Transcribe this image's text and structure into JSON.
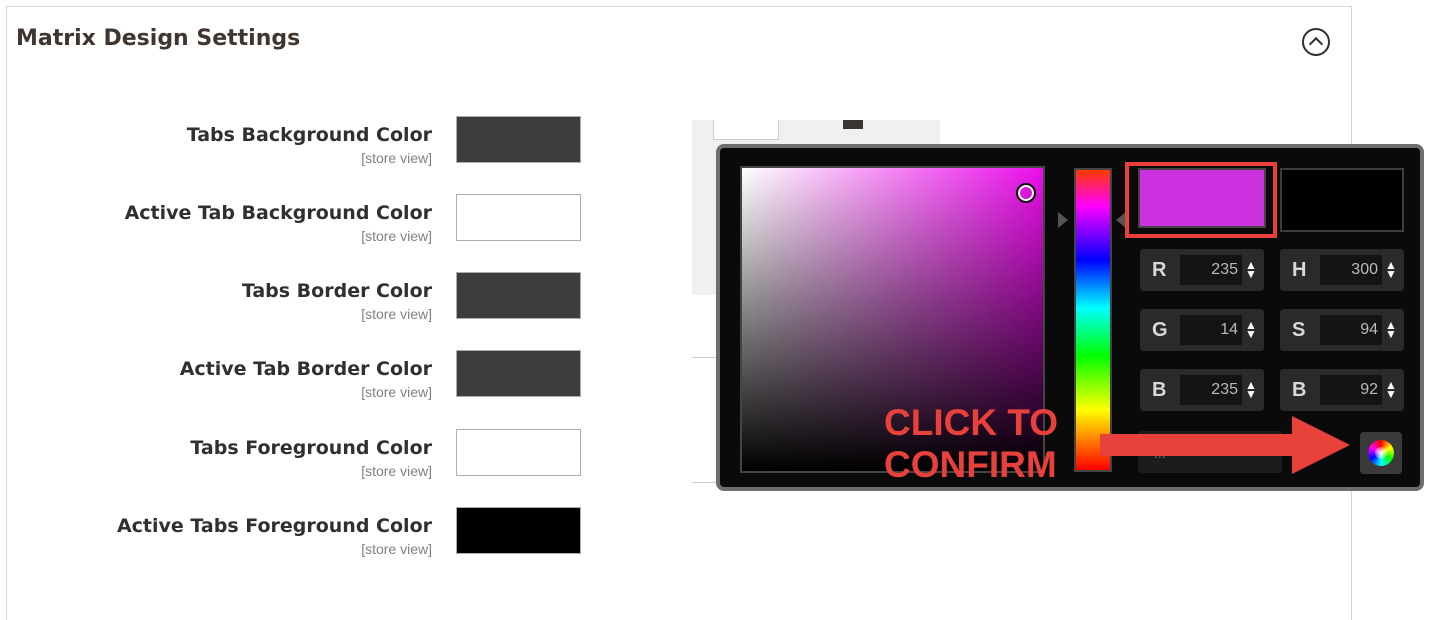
{
  "section": {
    "title": "Matrix Design Settings",
    "collapse_icon": "chevron-up-circle-icon"
  },
  "fields": [
    {
      "label": "Tabs Background Color",
      "scope": "[store view]",
      "swatch_color": "#3d3d3d"
    },
    {
      "label": "Active Tab Background Color",
      "scope": "[store view]",
      "swatch_color": "#ffffff"
    },
    {
      "label": "Tabs Border Color",
      "scope": "[store view]",
      "swatch_color": "#3d3d3d"
    },
    {
      "label": "Active Tab Border Color",
      "scope": "[store view]",
      "swatch_color": "#3d3d3d"
    },
    {
      "label": "Tabs Foreground Color",
      "scope": "[store view]",
      "swatch_color": "#ffffff"
    },
    {
      "label": "Active Tabs Foreground Color",
      "scope": "[store view]",
      "swatch_color": "#000000"
    }
  ],
  "color_picker": {
    "new_color": "#cc31e0",
    "current_color": "#000000",
    "channels": {
      "r": {
        "letter": "R",
        "value": "235"
      },
      "g": {
        "letter": "G",
        "value": "14"
      },
      "b": {
        "letter": "B",
        "value": "235"
      },
      "h": {
        "letter": "H",
        "value": "300"
      },
      "s": {
        "letter": "S",
        "value": "94"
      },
      "bv": {
        "letter": "B",
        "value": "92"
      }
    },
    "hex_placeholder": "...",
    "confirm_icon": "color-wheel-icon"
  },
  "annotation": {
    "line1": "CLICK TO",
    "line2": "CONFIRM",
    "color": "#e8413c"
  }
}
